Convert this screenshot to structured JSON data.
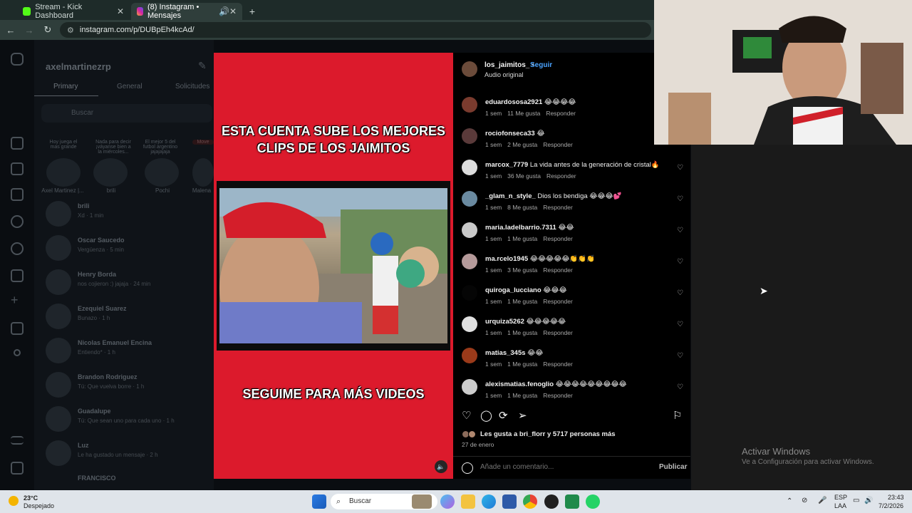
{
  "browser": {
    "tabs": [
      {
        "title": "Stream - Kick Dashboard",
        "icon": "kick-icon"
      },
      {
        "title": "(8) Instagram • Mensajes",
        "icon": "instagram-icon"
      }
    ],
    "url": "instagram.com/p/DUBpEh4kcAd/"
  },
  "dm": {
    "username": "axelmartinezrp",
    "tabs": [
      "Primary",
      "General",
      "Solicitudes"
    ],
    "search_placeholder": "Buscar",
    "notes": [
      {
        "text": "Hoy juega el mas grande",
        "name": "Axel Martinez |..."
      },
      {
        "text": "Nada para decir ¡váyanse bien a la miércoles...",
        "name": "brili"
      },
      {
        "text": "El mejor 5 del futbol argentino jajajajaja",
        "name": "Pochi"
      },
      {
        "text": "Move",
        "name": "Malena"
      }
    ],
    "conversations": [
      {
        "name": "brili",
        "preview": "Xd · 1 min"
      },
      {
        "name": "Oscar Saucedo",
        "preview": "Vergüenza · 5 min"
      },
      {
        "name": "Henry Borda",
        "preview": "nos cojieron :) jajaja · 24 min"
      },
      {
        "name": "Ezequiel Suarez",
        "preview": "Bunazo · 1 h"
      },
      {
        "name": "Nicolas Emanuel Encina",
        "preview": "Entiendo* · 1 h"
      },
      {
        "name": "Brandon Rodriguez",
        "preview": "Tú: Que vuelva borre · 1 h"
      },
      {
        "name": "Guadalupe",
        "preview": "Tú: Que sean uno para cada uno · 1 h"
      },
      {
        "name": "Luz",
        "preview": "Le ha gustado un mensaje · 2 h"
      },
      {
        "name": "FRANCISCO",
        "preview": ""
      }
    ]
  },
  "post": {
    "caption_top": "ESTA CUENTA SUBE LOS MEJORES CLIPS DE LOS JAIMITOS",
    "caption_bottom": "SEGUIME PARA MÁS VIDEOS",
    "author": "los_jaimitos_",
    "follow": "Seguir",
    "separator": "•",
    "audio": "Audio original",
    "comments": [
      {
        "user": "eduardososa2921",
        "text": "😂😂😂😂",
        "time": "1 sem",
        "likes": "11 Me gusta",
        "reply": "Responder",
        "avatar_color": "#7a3b2e"
      },
      {
        "user": "rociofonseca33",
        "text": "😂",
        "time": "1 sem",
        "likes": "2 Me gusta",
        "reply": "Responder",
        "avatar_color": "#5a3a3a"
      },
      {
        "user": "marcox_7779",
        "text": "La vida antes de la generación de cristal🔥",
        "time": "1 sem",
        "likes": "36 Me gusta",
        "reply": "Responder",
        "avatar_color": "#dcdcdc"
      },
      {
        "user": "_glam_n_style_",
        "text": "Dios los bendiga 😂😂😂💕",
        "time": "1 sem",
        "likes": "8 Me gusta",
        "reply": "Responder",
        "avatar_color": "#6a8aa0"
      },
      {
        "user": "maria.ladelbarrio.7311",
        "text": "😂😂",
        "time": "1 sem",
        "likes": "1 Me gusta",
        "reply": "Responder",
        "avatar_color": "#c9c9c9"
      },
      {
        "user": "ma.rcelo1945",
        "text": "😂😂😂😂😂👏👏👏",
        "time": "1 sem",
        "likes": "3 Me gusta",
        "reply": "Responder",
        "avatar_color": "#b59a9a"
      },
      {
        "user": "quiroga_lucciano",
        "text": "😂😂😂",
        "time": "1 sem",
        "likes": "1 Me gusta",
        "reply": "Responder",
        "avatar_color": "#050505"
      },
      {
        "user": "urquiza5262",
        "text": "😂😂😂😂😂",
        "time": "1 sem",
        "likes": "1 Me gusta",
        "reply": "Responder",
        "avatar_color": "#e0e0e0"
      },
      {
        "user": "matias_345s",
        "text": "😂😂",
        "time": "1 sem",
        "likes": "1 Me gusta",
        "reply": "Responder",
        "avatar_color": "#9a3a1a"
      },
      {
        "user": "alexismatias.fenoglio",
        "text": "😂😂😂😂😂😂😂😂😂",
        "time": "1 sem",
        "likes": "1 Me gusta",
        "reply": "Responder",
        "avatar_color": "#cccccc"
      }
    ],
    "likes_text": "Les gusta a bri_florr y 5717 personas más",
    "date": "27 de enero",
    "comment_placeholder": "Añade un comentario...",
    "publish": "Publicar"
  },
  "windows": {
    "activate_title": "Activar Windows",
    "activate_sub": "Ve a Configuración para activar Windows."
  },
  "taskbar": {
    "weather_temp": "23°C",
    "weather_desc": "Despejado",
    "search": "Buscar",
    "lang1": "ESP",
    "lang2": "LAA",
    "time": "23:43",
    "date": "7/2/2026"
  },
  "colors": {
    "media_red": "#dc1a2c",
    "follow_blue": "#4aa3ff"
  }
}
